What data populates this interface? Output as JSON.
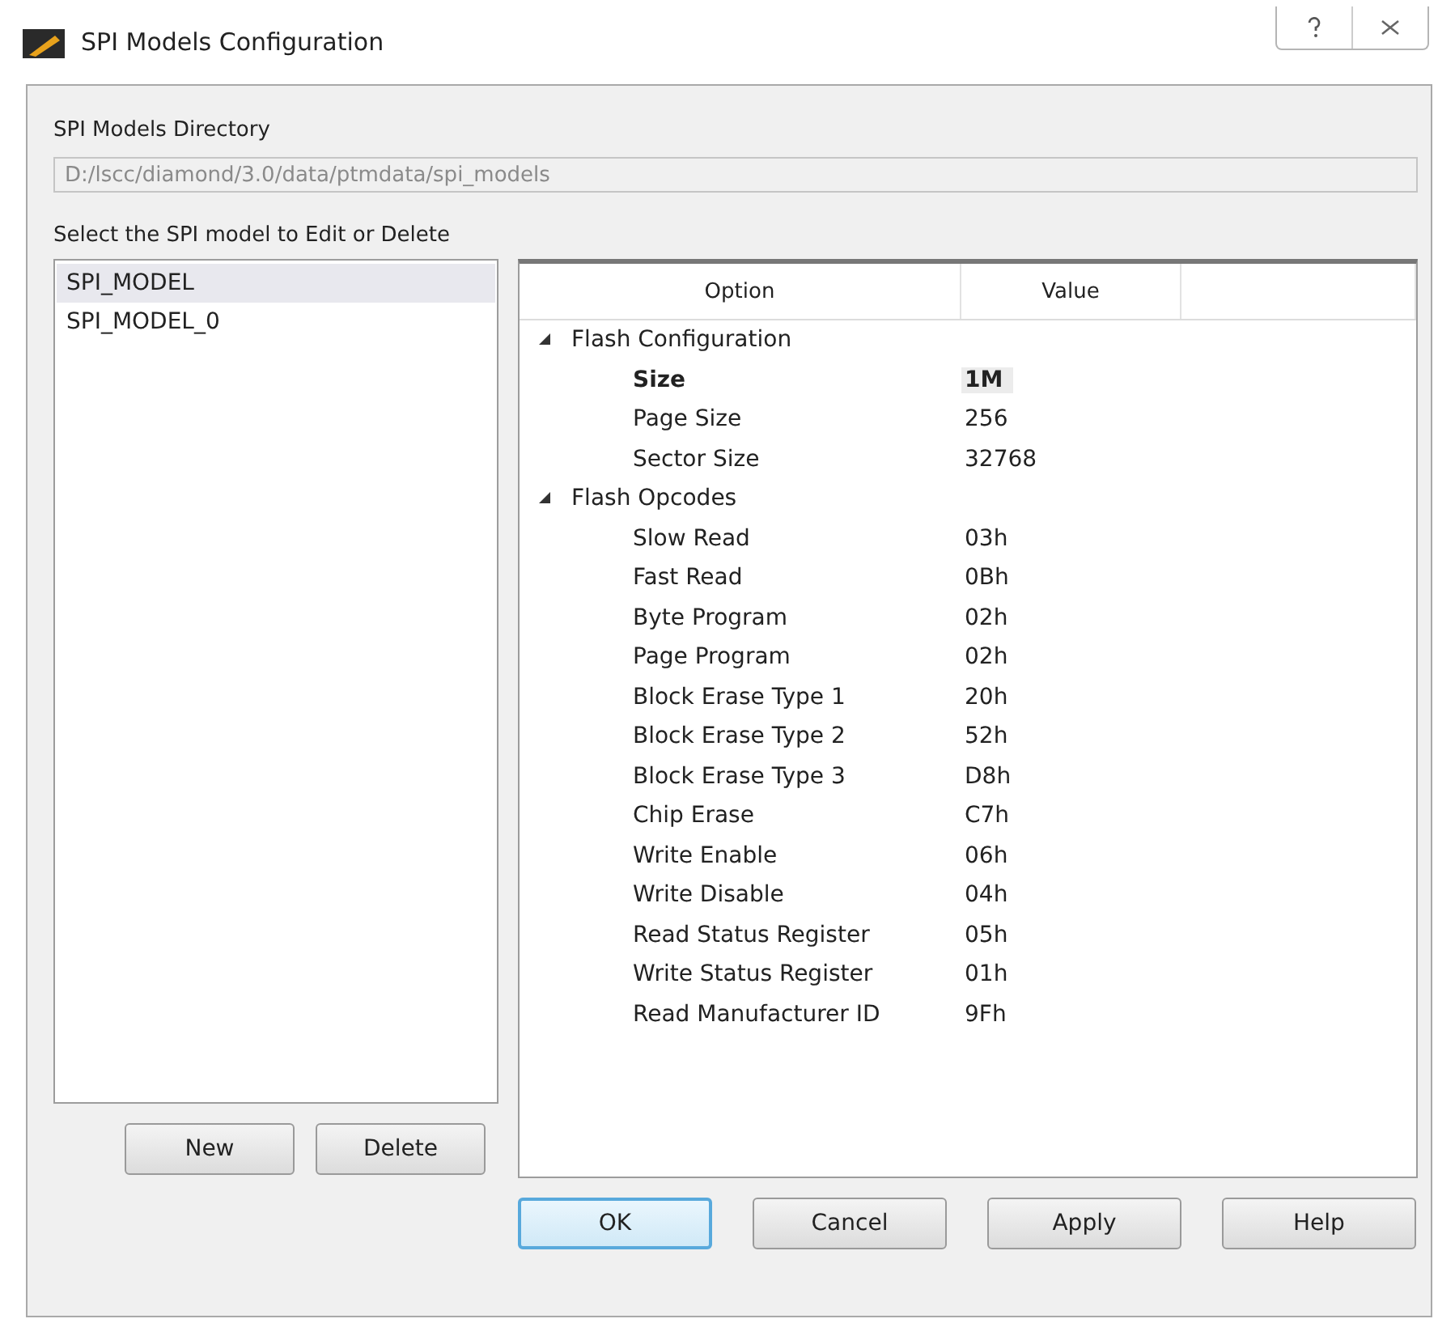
{
  "window": {
    "title": "SPI Models Configuration"
  },
  "directory": {
    "label": "SPI Models Directory",
    "value": "D:/lscc/diamond/3.0/data/ptmdata/spi_models",
    "disabled": true
  },
  "models": {
    "label": "Select the SPI model to Edit or Delete",
    "items": [
      {
        "label": "SPI_MODEL",
        "selected": true
      },
      {
        "label": "SPI_MODEL_0",
        "selected": false
      }
    ],
    "buttons": [
      "New",
      "Delete"
    ]
  },
  "options": {
    "columns": [
      "Option",
      "Value"
    ],
    "groups": [
      {
        "label": "Flash Configuration",
        "expanded": true,
        "children": [
          {
            "option": "Size",
            "value": "1M",
            "selected": true
          },
          {
            "option": "Page Size",
            "value": "256",
            "selected": false
          },
          {
            "option": "Sector Size",
            "value": "32768",
            "selected": false
          }
        ]
      },
      {
        "label": "Flash Opcodes",
        "expanded": true,
        "children": [
          {
            "option": "Slow Read",
            "value": "03h",
            "selected": false
          },
          {
            "option": "Fast Read",
            "value": "0Bh",
            "selected": false
          },
          {
            "option": "Byte Program",
            "value": "02h",
            "selected": false
          },
          {
            "option": "Page Program",
            "value": "02h",
            "selected": false
          },
          {
            "option": "Block Erase Type 1",
            "value": "20h",
            "selected": false
          },
          {
            "option": "Block Erase Type 2",
            "value": "52h",
            "selected": false
          },
          {
            "option": "Block Erase Type 3",
            "value": "D8h",
            "selected": false
          },
          {
            "option": "Chip Erase",
            "value": "C7h",
            "selected": false
          },
          {
            "option": "Write Enable",
            "value": "06h",
            "selected": false
          },
          {
            "option": "Write Disable",
            "value": "04h",
            "selected": false
          },
          {
            "option": "Read Status Register",
            "value": "05h",
            "selected": false
          },
          {
            "option": "Write Status Register",
            "value": "01h",
            "selected": false
          },
          {
            "option": "Read Manufacturer ID",
            "value": "9Fh",
            "selected": false
          }
        ]
      }
    ]
  },
  "buttons": [
    {
      "label": "OK",
      "default": true
    },
    {
      "label": "Cancel",
      "default": false
    },
    {
      "label": "Apply",
      "default": false
    },
    {
      "label": "Help",
      "default": false
    }
  ]
}
